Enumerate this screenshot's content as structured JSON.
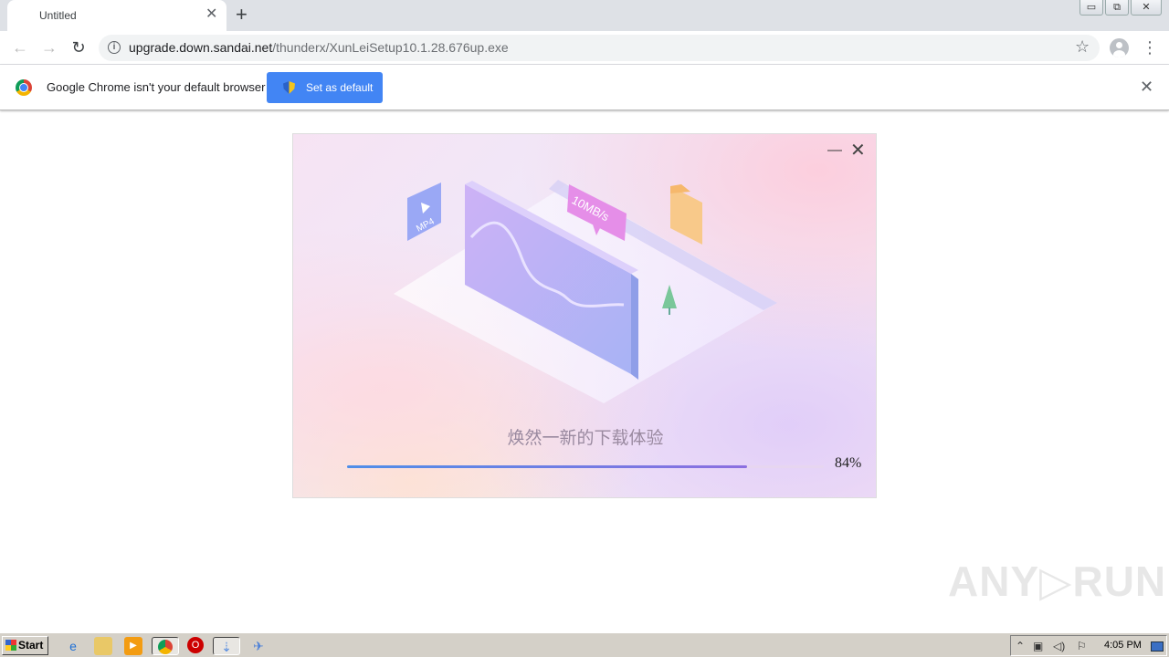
{
  "browser": {
    "tab": {
      "title": "Untitled",
      "close": "✕"
    },
    "new_tab": "+",
    "window_controls": {
      "minimize": "▭",
      "restore": "⧉",
      "close": "✕"
    },
    "nav": {
      "back": "←",
      "forward": "→",
      "reload": "↻"
    },
    "address": {
      "domain": "upgrade.down.sandai.net",
      "path": "/thunderx/XunLeiSetup10.1.28.676up.exe",
      "info": "i"
    },
    "bookmark": "☆",
    "menu": "⋮"
  },
  "infobar": {
    "message": "Google Chrome isn't your default browser",
    "button": "Set as default",
    "close": "✕"
  },
  "installer": {
    "minimize": "—",
    "close": "✕",
    "illustration": {
      "badge_speed": "10MB/s",
      "file_label": "MP4"
    },
    "tagline": "焕然一新的下载体验",
    "progress_fraction": 0.84,
    "progress_text": "84%"
  },
  "taskbar": {
    "start": "Start",
    "clock": "4:05 PM",
    "icons": [
      "ie-icon",
      "explorer-icon",
      "media-player-icon",
      "chrome-icon",
      "opera-icon",
      "xunlei-icon",
      "thunder-bird-icon"
    ]
  },
  "watermark": "ANY▷RUN",
  "colors": {
    "accent": "#4285f4",
    "progress_start": "#4f8ee8",
    "progress_end": "#8c6fe0"
  }
}
